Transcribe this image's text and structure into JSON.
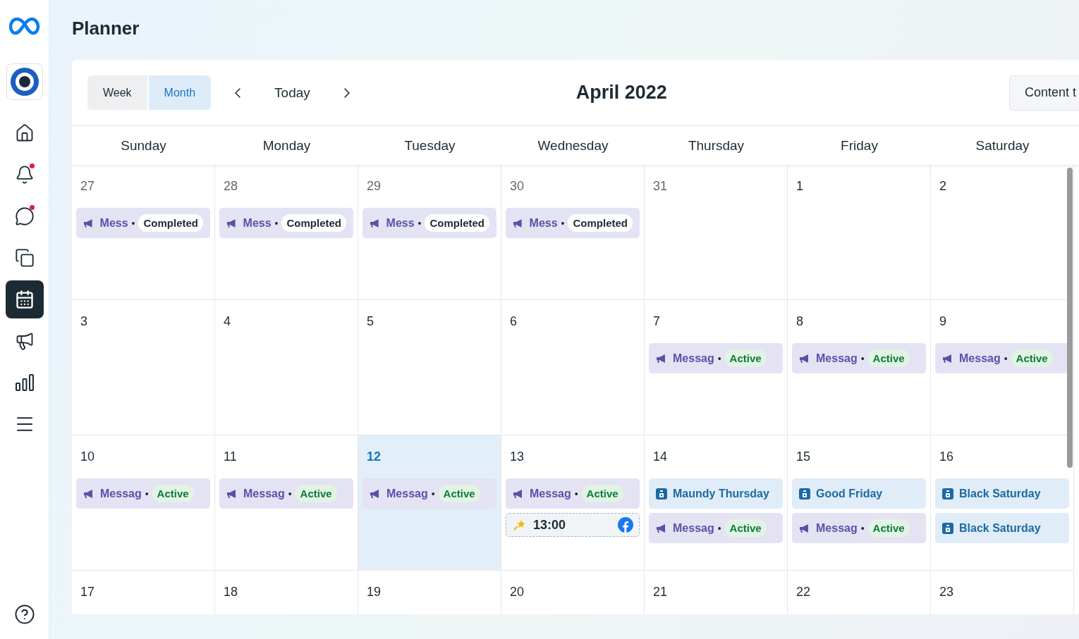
{
  "page_title": "Planner",
  "sidebar": {
    "items": [
      {
        "selected": false,
        "notification": false
      },
      {
        "selected": false,
        "notification": true
      },
      {
        "selected": false,
        "notification": true
      },
      {
        "selected": false,
        "notification": false
      },
      {
        "selected": true,
        "notification": false
      },
      {
        "selected": false,
        "notification": false
      },
      {
        "selected": false,
        "notification": false
      },
      {
        "selected": false,
        "notification": false
      }
    ]
  },
  "toolbar": {
    "views": [
      {
        "label": "Week",
        "selected": false
      },
      {
        "label": "Month",
        "selected": true
      }
    ],
    "today": "Today",
    "title": "April 2022",
    "content_button": "Content t"
  },
  "weekdays": [
    "Sunday",
    "Monday",
    "Tuesday",
    "Wednesday",
    "Thursday",
    "Friday",
    "Saturday"
  ],
  "weeks": [
    [
      {
        "date": "27",
        "in_month": false,
        "today": false,
        "events": [
          {
            "kind": "campaign",
            "title": "Mess",
            "separator": "•",
            "status": "Completed",
            "completed": true
          }
        ]
      },
      {
        "date": "28",
        "in_month": false,
        "today": false,
        "events": [
          {
            "kind": "campaign",
            "title": "Mess",
            "separator": "•",
            "status": "Completed",
            "completed": true
          }
        ]
      },
      {
        "date": "29",
        "in_month": false,
        "today": false,
        "events": [
          {
            "kind": "campaign",
            "title": "Mess",
            "separator": "•",
            "status": "Completed",
            "completed": true
          }
        ]
      },
      {
        "date": "30",
        "in_month": false,
        "today": false,
        "events": [
          {
            "kind": "campaign",
            "title": "Mess",
            "separator": "•",
            "status": "Completed",
            "completed": true
          }
        ]
      },
      {
        "date": "31",
        "in_month": false,
        "today": false
      },
      {
        "date": "1",
        "in_month": true,
        "today": false
      },
      {
        "date": "2",
        "in_month": true,
        "today": false
      }
    ],
    [
      {
        "date": "3",
        "in_month": true,
        "today": false
      },
      {
        "date": "4",
        "in_month": true,
        "today": false
      },
      {
        "date": "5",
        "in_month": true,
        "today": false
      },
      {
        "date": "6",
        "in_month": true,
        "today": false
      },
      {
        "date": "7",
        "in_month": true,
        "today": false,
        "events": [
          {
            "kind": "campaign",
            "title": "Messag",
            "separator": "•",
            "status": "Active",
            "completed": false
          }
        ]
      },
      {
        "date": "8",
        "in_month": true,
        "today": false,
        "events": [
          {
            "kind": "campaign",
            "title": "Messag",
            "separator": "•",
            "status": "Active",
            "completed": false
          }
        ]
      },
      {
        "date": "9",
        "in_month": true,
        "today": false,
        "events": [
          {
            "kind": "campaign",
            "title": "Messag",
            "separator": "•",
            "status": "Active",
            "completed": false
          }
        ]
      }
    ],
    [
      {
        "date": "10",
        "in_month": true,
        "today": false,
        "events": [
          {
            "kind": "campaign",
            "title": "Messag",
            "separator": "•",
            "status": "Active",
            "completed": false
          }
        ]
      },
      {
        "date": "11",
        "in_month": true,
        "today": false,
        "events": [
          {
            "kind": "campaign",
            "title": "Messag",
            "separator": "•",
            "status": "Active",
            "completed": false
          }
        ]
      },
      {
        "date": "12",
        "in_month": true,
        "today": true,
        "events": [
          {
            "kind": "campaign",
            "title": "Messag",
            "separator": "•",
            "status": "Active",
            "completed": false
          }
        ]
      },
      {
        "date": "13",
        "in_month": true,
        "today": false,
        "events": [
          {
            "kind": "campaign",
            "title": "Messag",
            "separator": "•",
            "status": "Active",
            "completed": false
          },
          {
            "kind": "scheduled",
            "time": "13:00"
          }
        ]
      },
      {
        "date": "14",
        "in_month": true,
        "today": false,
        "events": [
          {
            "kind": "holiday",
            "title": "Maundy Thursday"
          },
          {
            "kind": "campaign",
            "title": "Messag",
            "separator": "•",
            "status": "Active",
            "completed": false
          }
        ]
      },
      {
        "date": "15",
        "in_month": true,
        "today": false,
        "events": [
          {
            "kind": "holiday",
            "title": "Good Friday"
          },
          {
            "kind": "campaign",
            "title": "Messag",
            "separator": "•",
            "status": "Active",
            "completed": false
          }
        ]
      },
      {
        "date": "16",
        "in_month": true,
        "today": false,
        "events": [
          {
            "kind": "holiday",
            "title": "Black Saturday"
          },
          {
            "kind": "holiday",
            "title": "Black Saturday"
          }
        ]
      }
    ],
    [
      {
        "date": "17",
        "in_month": true,
        "today": false
      },
      {
        "date": "18",
        "in_month": true,
        "today": false
      },
      {
        "date": "19",
        "in_month": true,
        "today": false
      },
      {
        "date": "20",
        "in_month": true,
        "today": false
      },
      {
        "date": "21",
        "in_month": true,
        "today": false
      },
      {
        "date": "22",
        "in_month": true,
        "today": false
      },
      {
        "date": "23",
        "in_month": true,
        "today": false
      }
    ]
  ]
}
